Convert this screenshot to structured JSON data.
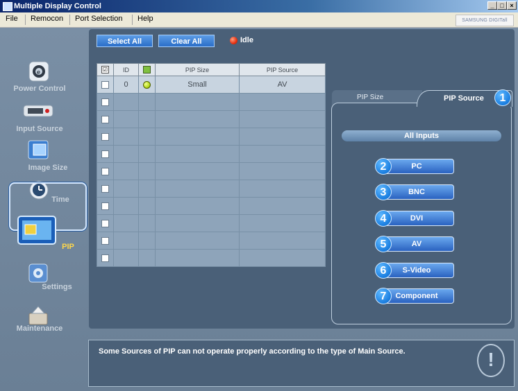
{
  "window": {
    "title": "Multiple Display Control",
    "controls": [
      "_",
      "□",
      "×"
    ]
  },
  "menu": {
    "items": [
      "File",
      "Remocon",
      "Port Selection",
      "Help"
    ],
    "brand": "SAMSUNG DIGITall"
  },
  "sidebar": {
    "items": [
      {
        "label": "Power Control",
        "icon": "power-control-icon"
      },
      {
        "label": "Input Source",
        "icon": "input-source-icon"
      },
      {
        "label": "Image Size",
        "icon": "image-size-icon"
      },
      {
        "label": "Time",
        "icon": "clock-icon"
      },
      {
        "label": "PIP",
        "icon": "pip-icon",
        "selected": true
      },
      {
        "label": "Settings",
        "icon": "settings-icon"
      },
      {
        "label": "Maintenance",
        "icon": "maintenance-icon"
      }
    ]
  },
  "toolbar": {
    "select_all": "Select All",
    "clear_all": "Clear All",
    "status": "Idle"
  },
  "table": {
    "headers": [
      "☑",
      "ID",
      "▣",
      "PIP Size",
      "PIP Source"
    ],
    "rows": [
      {
        "id": "0",
        "size": "Small",
        "source": "AV"
      }
    ],
    "empty_rows": 10
  },
  "tabs": {
    "pip_size": "PIP Size",
    "pip_source": "PIP Source"
  },
  "sources": {
    "header": "All Inputs",
    "buttons": [
      {
        "num": "2",
        "label": "PC"
      },
      {
        "num": "3",
        "label": "BNC"
      },
      {
        "num": "4",
        "label": "DVI"
      },
      {
        "num": "5",
        "label": "AV"
      },
      {
        "num": "6",
        "label": "S-Video"
      },
      {
        "num": "7",
        "label": "Component"
      }
    ],
    "tab_marker": "1"
  },
  "message": "Some Sources of PIP can not operate properly according to the type of Main Source.",
  "colors": {
    "accent": "#2a6ec8",
    "panel": "#4a6078",
    "status_idle": "#e83010"
  }
}
